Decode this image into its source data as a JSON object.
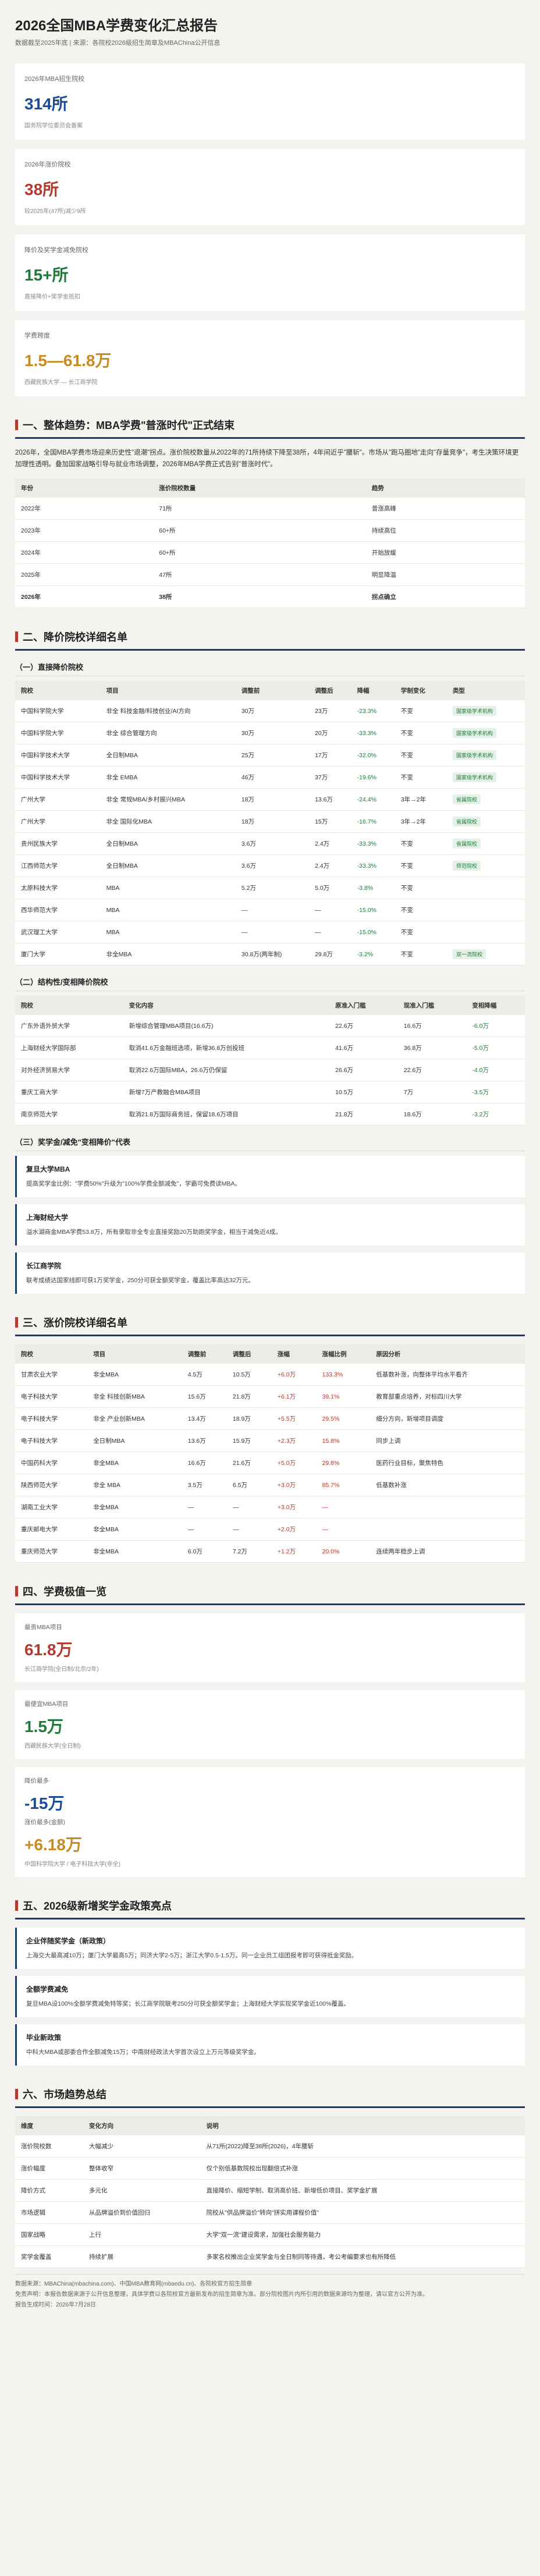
{
  "header": {
    "title": "2026全国MBA学费变化汇总报告",
    "meta": "数据截至2025年底 | 来源：各院校2026级招生简章及MBAChina公开信息"
  },
  "kpis": [
    {
      "label": "2026年MBA招生院校",
      "value": "314所",
      "sub": "国务院学位委员会备案"
    },
    {
      "label": "2026年涨价院校",
      "value": "38所",
      "sub": "较2025年(47所)减少9所"
    },
    {
      "label": "降价及奖学金减免院校",
      "value": "15+所",
      "sub": "直接降价+奖学金抵扣"
    },
    {
      "label": "学费跨度",
      "value": "1.5—61.8万",
      "sub": "西藏民族大学 — 长江商学院"
    }
  ],
  "s1": {
    "title": "一、整体趋势：MBA学费\"普涨时代\"正式结束",
    "para": "2026年，全国MBA学费市场迎来历史性\"退潮\"拐点。涨价院校数量从2022年的71所持续下降至38所，4年间近乎\"腰斩\"。市场从\"跑马圈地\"走向\"存量竞争\"，考生决策环境更加理性透明。叠加国家战略引导与就业市场调整，2026年MBA学费正式告别\"普涨时代\"。",
    "cols": [
      "年份",
      "涨价院校数量",
      "趋势"
    ],
    "rows": [
      [
        "2022年",
        "71所",
        "普涨高峰"
      ],
      [
        "2023年",
        "60+所",
        "持续高位"
      ],
      [
        "2024年",
        "60+所",
        "开始放缓"
      ],
      [
        "2025年",
        "47所",
        "明显降温"
      ],
      [
        "2026年",
        "38所",
        "拐点确立"
      ]
    ]
  },
  "s2": {
    "title": "二、降价院校详细名单",
    "sub1": "（一）直接降价院校",
    "cols1": [
      "院校",
      "项目",
      "调整前",
      "调整后",
      "降幅",
      "学制变化",
      "类型"
    ],
    "rows1": [
      [
        "中国科学院大学",
        "非全 科技金融/科技创业/AI方向",
        "30万",
        "23万",
        "-23.3%",
        "不变",
        "国家级学术机构"
      ],
      [
        "中国科学院大学",
        "非全 综合管理方向",
        "30万",
        "20万",
        "-33.3%",
        "不变",
        "国家级学术机构"
      ],
      [
        "中国科学技术大学",
        "全日制MBA",
        "25万",
        "17万",
        "-32.0%",
        "不变",
        "国家级学术机构"
      ],
      [
        "中国科学技术大学",
        "非全 EMBA",
        "46万",
        "37万",
        "-19.6%",
        "不变",
        "国家级学术机构"
      ],
      [
        "广州大学",
        "非全 常规MBA/乡村振兴MBA",
        "18万",
        "13.6万",
        "-24.4%",
        "3年→2年",
        "省属院校"
      ],
      [
        "广州大学",
        "非全 国际化MBA",
        "18万",
        "15万",
        "-16.7%",
        "3年→2年",
        "省属院校"
      ],
      [
        "贵州民族大学",
        "全日制MBA",
        "3.6万",
        "2.4万",
        "-33.3%",
        "不变",
        "省属院校"
      ],
      [
        "江西师范大学",
        "全日制MBA",
        "3.6万",
        "2.4万",
        "-33.3%",
        "不变",
        "师范院校"
      ],
      [
        "太原科技大学",
        "MBA",
        "5.2万",
        "5.0万",
        "-3.8%",
        "不变",
        ""
      ],
      [
        "西华师范大学",
        "MBA",
        "—",
        "—",
        "-15.0%",
        "不变",
        ""
      ],
      [
        "武汉理工大学",
        "MBA",
        "—",
        "—",
        "-15.0%",
        "不变",
        ""
      ],
      [
        "厦门大学",
        "非全MBA",
        "30.8万(两年制)",
        "29.8万",
        "-3.2%",
        "不变",
        "双一流院校"
      ]
    ],
    "sub2": "（二）结构性/变相降价院校",
    "cols2": [
      "院校",
      "变化内容",
      "原准入门槛",
      "现准入门槛",
      "变相降幅"
    ],
    "rows2": [
      [
        "广东外语外贸大学",
        "新增综合管理MBA项目(16.6万)",
        "22.6万",
        "16.6万",
        "-6.0万"
      ],
      [
        "上海财经大学国际部",
        "取消41.6万金融班选项，新增36.8万创投班",
        "41.6万",
        "36.8万",
        "-5.0万"
      ],
      [
        "对外经济贸易大学",
        "取消22.6万国际MBA，26.6万仍保留",
        "26.6万",
        "22.6万",
        "-4.0万"
      ],
      [
        "重庆工商大学",
        "新增7万产教融合MBA项目",
        "10.5万",
        "7万",
        "-3.5万"
      ],
      [
        "南京师范大学",
        "取消21.8万国际商务班，保留18.6万项目",
        "21.8万",
        "18.6万",
        "-3.2万"
      ]
    ],
    "sub3": "（三）奖学金/减免\"变相降价\"代表",
    "cards": [
      {
        "t": "复旦大学MBA",
        "b": "提高奖学金比例：\"学费50%\"升级为\"100%学费全额减免\"，学霸可免费读MBA。"
      },
      {
        "t": "上海财经大学",
        "b": "溢水湖商金MBA学费53.8万，所有录取非全专业直接奖励20万助跑奖学金，相当于减免近4成。"
      },
      {
        "t": "长江商学院",
        "b": "联考成绩达国家线即可获1万奖学金，250分可获全额奖学金，覆盖比率高达32万元。"
      }
    ]
  },
  "s3": {
    "title": "三、涨价院校详细名单",
    "cols": [
      "院校",
      "项目",
      "调整前",
      "调整后",
      "涨幅",
      "涨幅比例",
      "原因分析"
    ],
    "rows": [
      [
        "甘肃农业大学",
        "非全MBA",
        "4.5万",
        "10.5万",
        "+6.0万",
        "133.3%",
        "低基数补涨，向整体平均水平看齐"
      ],
      [
        "电子科技大学",
        "非全 科技创新MBA",
        "15.6万",
        "21.8万",
        "+6.1万",
        "39.1%",
        "教育部重点培养，对标四川大学"
      ],
      [
        "电子科技大学",
        "非全 产业创新MBA",
        "13.4万",
        "18.9万",
        "+5.5万",
        "29.5%",
        "细分方向，新增项目调度"
      ],
      [
        "电子科技大学",
        "全日制MBA",
        "13.6万",
        "15.9万",
        "+2.3万",
        "15.8%",
        "同步上调"
      ],
      [
        "中国药科大学",
        "非全MBA",
        "16.6万",
        "21.6万",
        "+5.0万",
        "29.8%",
        "医药行业目标，聚焦特色"
      ],
      [
        "陕西师范大学",
        "非全 MBA",
        "3.5万",
        "6.5万",
        "+3.0万",
        "85.7%",
        "低基数补涨"
      ],
      [
        "湖南工业大学",
        "非全MBA",
        "—",
        "—",
        "+3.0万",
        "—",
        ""
      ],
      [
        "重庆邮电大学",
        "非全MBA",
        "—",
        "—",
        "+2.0万",
        "—",
        ""
      ],
      [
        "重庆师范大学",
        "非全MBA",
        "6.0万",
        "7.2万",
        "+1.2万",
        "20.0%",
        "连续两年稳步上调"
      ]
    ]
  },
  "s4": {
    "title": "四、学费极值一览",
    "stats": [
      {
        "label": "最贵MBA项目",
        "value": "61.8万",
        "sub": "长江商学院(全日制/北京/2年)"
      },
      {
        "label": "最便宜MBA项目",
        "value": "1.5万",
        "sub": "西藏民族大学(全日制)"
      },
      {
        "label": "降价最多",
        "value": "-15万",
        "sub2label": "涨价最多(金额)",
        "value2": "+6.18万",
        "sub": "中国科学院大学 / 电子科技大学(非全)"
      }
    ]
  },
  "s5": {
    "title": "五、2026级新增奖学金政策亮点",
    "cards": [
      {
        "t": "企业伴随奖学金（新政策）",
        "b": "上海交大最高减10万；厦门大学最高5万；同济大学2-5万；浙江大学0.5-1.5万。同一企业员工组团报考即可获得抵金奖励。"
      },
      {
        "t": "全额学费减免",
        "b": "复旦MBA设100%全额学费减免特等奖；长江商学院联考250分可获全额奖学金；上海财经大学实现奖学金近100%覆盖。"
      },
      {
        "t": "毕业新政策",
        "b": "中科大MBA或部委合作全额减免15万；中南财经政法大学首次设立上万元等级奖学金。"
      }
    ]
  },
  "s6": {
    "title": "六、市场趋势总结",
    "cols": [
      "维度",
      "变化方向",
      "说明"
    ],
    "rows": [
      [
        "涨价院校数",
        "大幅减少",
        "从71所(2022)降至38所(2026)，4年腰斩"
      ],
      [
        "涨价幅度",
        "整体收窄",
        "仅个别低基数院校出现翻倍式补涨"
      ],
      [
        "降价方式",
        "多元化",
        "直接降价、缩短学制、取消高价班、新增低价项目、奖学金扩展"
      ],
      [
        "市场逻辑",
        "从品牌溢价到价值回归",
        "院校从\"供品牌溢价\"转向\"拼实用课程价值\""
      ],
      [
        "国家战略",
        "上行",
        "大学\"双一流\"建设需求，加强社会服务能力"
      ],
      [
        "奖学金覆盖",
        "持续扩展",
        "多家名校推出企业奖学金与全日制同等待遇，考公考编要求也有所降低"
      ]
    ]
  },
  "footer": {
    "lines": [
      "数据来源：MBAChina(mbachina.com)、中国MBA教育网(mbaedu.cn)、各院校官方招生简章",
      "免责声明：本报告数据来源于公开信息整理，具体学费以各院校官方最新发布的招生简章为准。部分院校图片内所引用的数据来源均为整理，请以官方公开为准。",
      "报告生成时间：2026年7月28日"
    ]
  }
}
